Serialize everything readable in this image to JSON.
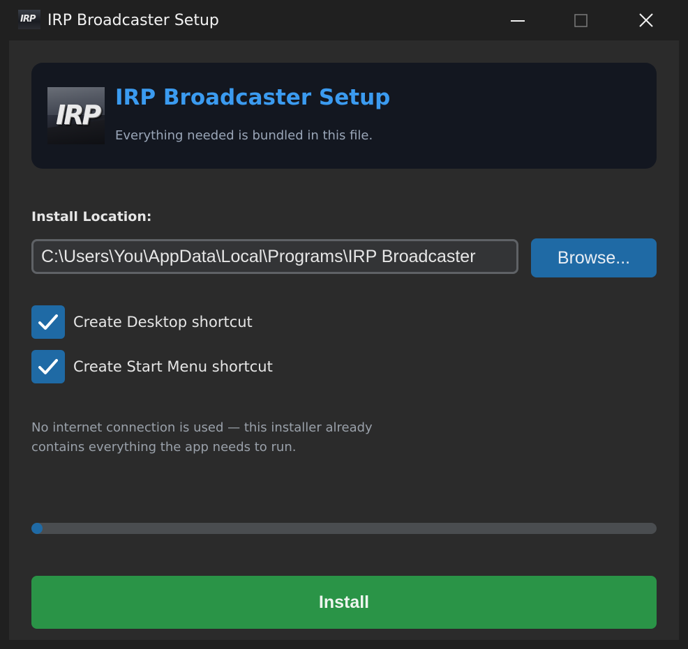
{
  "window": {
    "title": "IRP Broadcaster Setup",
    "icon_text": "IRP"
  },
  "header": {
    "logo_text": "IRP",
    "title": "IRP Broadcaster Setup",
    "subtitle": "Everything needed is bundled in this file."
  },
  "install": {
    "label": "Install Location:",
    "path_value": "C:\\Users\\You\\AppData\\Local\\Programs\\IRP Broadcaster",
    "browse_label": "Browse..."
  },
  "options": [
    {
      "label": "Create Desktop shortcut",
      "checked": true
    },
    {
      "label": "Create Start Menu shortcut",
      "checked": true
    }
  ],
  "note": {
    "line1": "No internet connection is used — this installer already",
    "line2": "contains everything the app needs to run."
  },
  "progress": {
    "fraction": 0.01
  },
  "actions": {
    "install_label": "Install"
  },
  "colors": {
    "accent_blue": "#1f6aa5",
    "title_blue": "#3b9bf0",
    "install_green": "#2a9447",
    "background": "#2b2b2b"
  },
  "icons": [
    "minimize-icon",
    "maximize-icon",
    "close-icon",
    "checkmark-icon"
  ]
}
